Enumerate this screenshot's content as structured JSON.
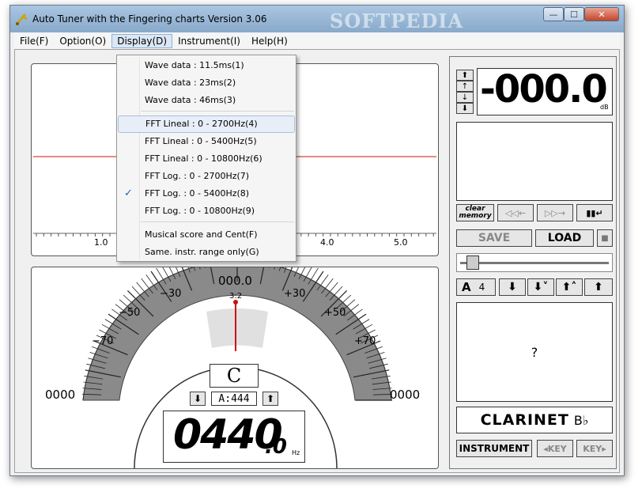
{
  "window": {
    "title": "Auto Tuner with the Fingering charts  Version 3.06",
    "watermark": "SOFTPEDIA",
    "minimize": "—",
    "maximize": "☐",
    "close": "✕"
  },
  "menubar": {
    "items": [
      "File(F)",
      "Option(O)",
      "Display(D)",
      "Instrument(I)",
      "Help(H)"
    ]
  },
  "display_menu": {
    "items": [
      {
        "label": "Wave data : 11.5ms(1)",
        "checked": false
      },
      {
        "label": "Wave data : 23ms(2)",
        "checked": false
      },
      {
        "label": "Wave data : 46ms(3)",
        "checked": false
      },
      {
        "label": "FFT Lineal : 0 - 2700Hz(4)",
        "checked": false,
        "highlighted": true
      },
      {
        "label": "FFT Lineal : 0 - 5400Hz(5)",
        "checked": false
      },
      {
        "label": "FFT Lineal : 0 - 10800Hz(6)",
        "checked": false
      },
      {
        "label": "FFT Log. : 0 - 2700Hz(7)",
        "checked": false
      },
      {
        "label": "FFT Log. : 0 - 5400Hz(8)",
        "checked": true
      },
      {
        "label": "FFT Log. : 0 - 10800Hz(9)",
        "checked": false
      },
      {
        "label": "Musical score and Cent(F)",
        "checked": false
      },
      {
        "label": "Same. instr. range only(G)",
        "checked": false
      }
    ],
    "check_glyph": "✓"
  },
  "spectrum": {
    "axis_labels": [
      "1.0",
      "4.0",
      "5.0"
    ],
    "watermark": "SOFTPEDIA"
  },
  "meter": {
    "center_value": "000.0",
    "scale_labels": {
      "m30": "−30",
      "p30": "+30",
      "m50": "−50",
      "p50": "+50",
      "m70": "−70",
      "p70": "+70"
    },
    "left_value": "0000",
    "right_value": "0000",
    "ratio_label": "3:2",
    "note": "C",
    "ref_pitch": "A:444",
    "frequency_main": "0440",
    "frequency_decimal": ".0",
    "frequency_unit": "Hz",
    "arrow_down": "⬇",
    "arrow_up": "⬆"
  },
  "right_panel": {
    "db_value": "-000.0",
    "db_unit": "dB",
    "clear_memory_line1": "clear",
    "clear_memory_line2": "memory",
    "rewind": "◁◁←",
    "forward": "▷▷→",
    "pause": "▮▮↵",
    "save": "SAVE",
    "load": "LOAD",
    "stop": "■",
    "transpose_letter": "A",
    "transpose_value": "4",
    "fingering": "?",
    "instrument_name": "CLARINET",
    "instrument_key": "B♭",
    "instrument_btn": "INSTRUMENT",
    "key_down": "◂KEY",
    "key_up": "KEY▸"
  },
  "colors": {
    "accent_red": "#cc1111",
    "meter_gray": "#8a8a8a",
    "menu_highlight": "#e8eef8"
  }
}
